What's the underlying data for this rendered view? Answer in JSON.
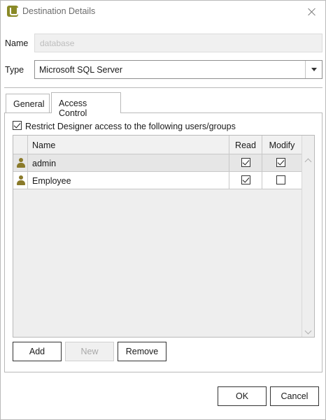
{
  "window": {
    "title": "Destination Details",
    "app_icon": "uniplex-logo-icon",
    "close_icon": "close-icon"
  },
  "fields": {
    "name_label": "Name",
    "name_placeholder": "database",
    "type_label": "Type",
    "type_value": "Microsoft SQL Server"
  },
  "tabs": [
    {
      "label": "General",
      "active": false
    },
    {
      "label": "Access Control",
      "active": true
    }
  ],
  "access_control": {
    "restrict_label": "Restrict Designer access to the following users/groups",
    "restrict_checked": true,
    "columns": [
      "Name",
      "Read",
      "Modify"
    ],
    "rows": [
      {
        "icon": "user-icon",
        "name": "admin",
        "read": true,
        "modify": true,
        "selected": true
      },
      {
        "icon": "user-icon",
        "name": "Employee",
        "read": true,
        "modify": false,
        "selected": false
      }
    ],
    "buttons": {
      "add": "Add",
      "new": "New",
      "remove": "Remove"
    }
  },
  "footer": {
    "ok": "OK",
    "cancel": "Cancel"
  },
  "colors": {
    "accent_icon": "#8a8a27",
    "user_icon": "#8a7a2a",
    "border": "#b9b9b9"
  }
}
